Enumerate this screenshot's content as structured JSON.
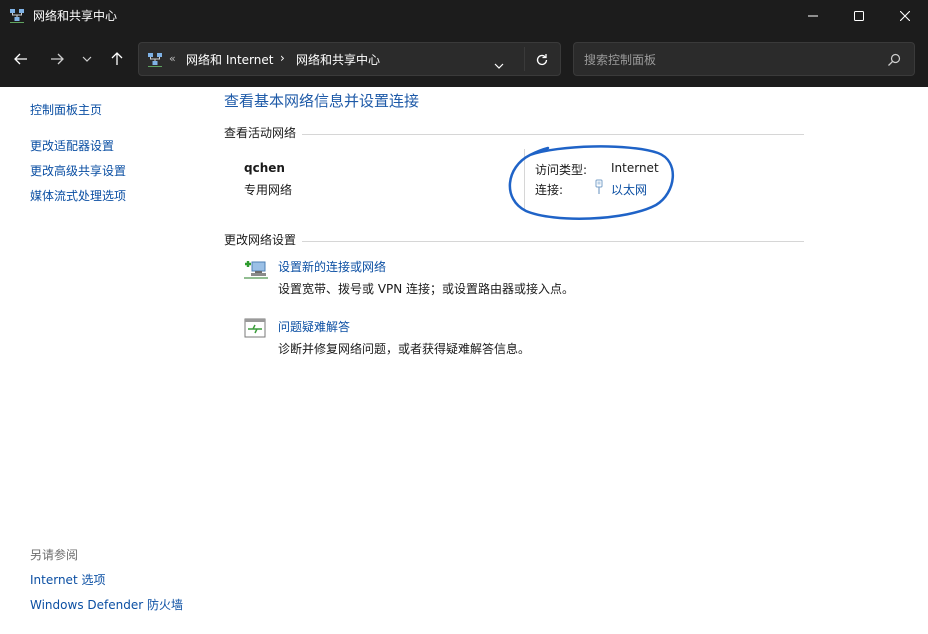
{
  "window": {
    "title": "网络和共享中心"
  },
  "address_bar": {
    "overflow_label": "«",
    "crumbs": [
      "网络和 Internet",
      "网络和共享中心"
    ],
    "separator": "›"
  },
  "search": {
    "placeholder": "搜索控制面板"
  },
  "sidebar": {
    "home": "控制面板主页",
    "items": [
      "更改适配器设置",
      "更改高级共享设置",
      "媒体流式处理选项"
    ],
    "see_also_title": "另请参阅",
    "see_also": [
      "Internet 选项",
      "Windows Defender 防火墙"
    ]
  },
  "main": {
    "title": "查看基本网络信息并设置连接",
    "active_section": "查看活动网络",
    "network": {
      "name": "qchen",
      "type": "专用网络",
      "access_type_label": "访问类型:",
      "access_type_value": "Internet",
      "connection_label": "连接:",
      "connection_value": "以太网"
    },
    "change_section": "更改网络设置",
    "tasks": [
      {
        "label": "设置新的连接或网络",
        "desc": "设置宽带、拨号或 VPN 连接；或设置路由器或接入点。",
        "icon": "new-connection-icon"
      },
      {
        "label": "问题疑难解答",
        "desc": "诊断并修复网络问题，或者获得疑难解答信息。",
        "icon": "troubleshoot-icon"
      }
    ]
  },
  "colors": {
    "titlebar_bg": "#1c1c1c",
    "link": "#0b4fa3",
    "title_blue": "#1e5aa8",
    "annotation_circle": "#1f63c7"
  }
}
